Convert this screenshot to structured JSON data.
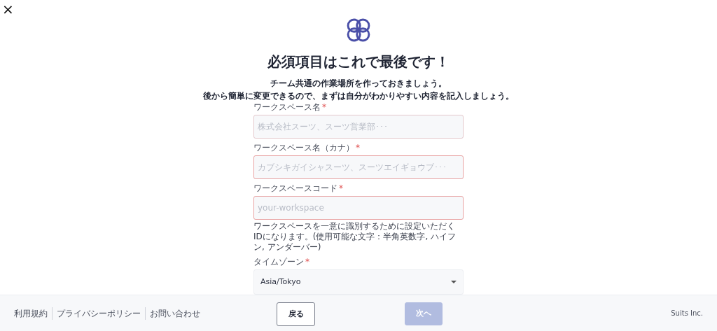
{
  "close": "×",
  "title": "必須項目はこれで最後です！",
  "subtitle": [
    "チーム共通の作業場所を作っておきましょう。",
    "後から簡単に変更できるので、まずは自分がわかりやすい内容を記入しましょう。"
  ],
  "fields": [
    {
      "kind": "input",
      "label": "ワークスペース名",
      "required_mark": "*",
      "placeholder": "株式会社スーツ、スーツ営業部･･･",
      "invalid": false
    },
    {
      "kind": "input",
      "label": "ワークスペース名（カナ）",
      "required_mark": "*",
      "placeholder": "カブシキガイシャスーツ、スーツエイギョウブ･･･",
      "invalid": true
    },
    {
      "kind": "input",
      "label": "ワークスペースコード",
      "required_mark": "*",
      "placeholder": "your-workspace",
      "invalid": true,
      "help": "ワークスペースを一意に識別するために設定いただくIDになります。(使用可能な文字：半角英数字, ハイフン, アンダーバー)"
    },
    {
      "kind": "select",
      "label": "タイムゾーン",
      "required_mark": "*",
      "value": "Asia/Tokyo"
    }
  ],
  "footer": {
    "links": [
      "利用規約",
      "プライバシーポリシー",
      "お問い合わせ"
    ],
    "back_button": {
      "label": "戻る",
      "disabled": false
    },
    "next_button": {
      "label": "次へ",
      "disabled": true
    },
    "company": "Suits Inc."
  }
}
